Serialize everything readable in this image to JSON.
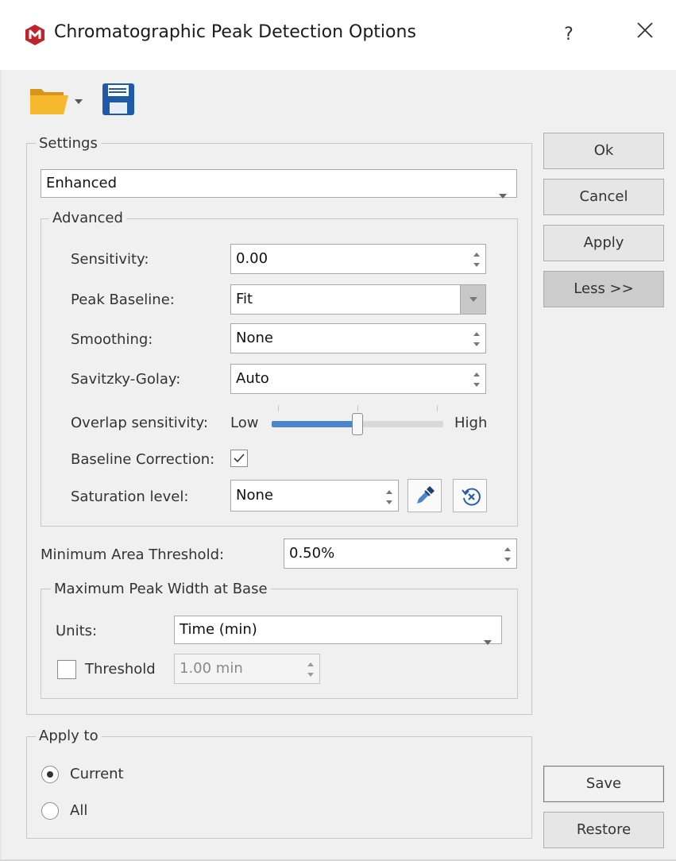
{
  "window": {
    "title": "Chromatographic Peak Detection Options",
    "help_label": "?",
    "close_icon": "close-icon",
    "app_icon": "app-logo-icon"
  },
  "toolbar": {
    "open_icon": "folder-open-icon",
    "dropdown_icon": "chevron-down-icon",
    "save_icon": "floppy-disk-icon"
  },
  "settings": {
    "group_label": "Settings",
    "preset_value": "Enhanced",
    "advanced": {
      "group_label": "Advanced",
      "sensitivity_label": "Sensitivity:",
      "sensitivity_value": "0.00",
      "peak_baseline_label": "Peak Baseline:",
      "peak_baseline_value": "Fit",
      "smoothing_label": "Smoothing:",
      "smoothing_value": "None",
      "savitzky_label": "Savitzky-Golay:",
      "savitzky_value": "Auto",
      "overlap_label": "Overlap sensitivity:",
      "overlap_low": "Low",
      "overlap_high": "High",
      "overlap_level": 0.5,
      "baseline_correction_label": "Baseline Correction:",
      "baseline_correction_checked": true,
      "saturation_label": "Saturation level:",
      "saturation_value": "None"
    },
    "min_area_label": "Minimum Area Threshold:",
    "min_area_value": "0.50%",
    "max_peak": {
      "group_label": "Maximum Peak Width at Base",
      "units_label": "Units:",
      "units_value": "Time (min)",
      "threshold_label": "Threshold",
      "threshold_checked": false,
      "threshold_value": "1.00 min"
    }
  },
  "apply_to": {
    "group_label": "Apply to",
    "options": [
      {
        "label": "Current",
        "selected": true
      },
      {
        "label": "All",
        "selected": false
      }
    ]
  },
  "buttons": {
    "ok": "Ok",
    "cancel": "Cancel",
    "apply": "Apply",
    "less": "Less >>",
    "save": "Save",
    "restore": "Restore"
  },
  "colors": {
    "accent": "#4a86c8",
    "folder": "#f2b12b",
    "save": "#1f5aa8",
    "logo": "#c0232b"
  }
}
